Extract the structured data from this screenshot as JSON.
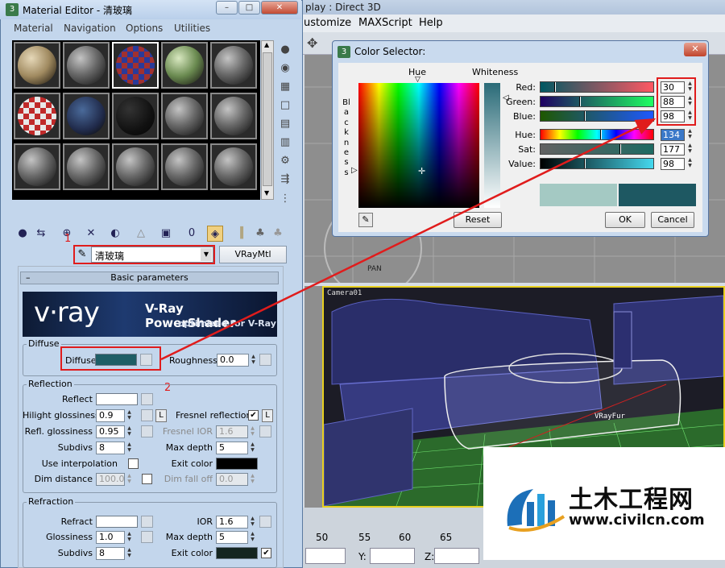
{
  "background": {
    "title": "play : Direct 3D",
    "menu": [
      "ustomize",
      "MAXScript",
      "Help"
    ],
    "camera_label": "Camera01",
    "vrayfur_label": "VRayFur",
    "pan_label": "PAN",
    "ruler": [
      "50",
      "55",
      "60",
      "65"
    ],
    "coord_y": "Y:",
    "coord_z": "Z:"
  },
  "material_editor": {
    "title": "Material Editor - 清玻璃",
    "menu": [
      "Material",
      "Navigation",
      "Options",
      "Utilities"
    ],
    "material_name": "清玻璃",
    "material_type": "VRayMtl",
    "rollout_title": "Basic parameters",
    "vray_banner": {
      "logo": "v·ray",
      "title": "V-Ray PowerShader",
      "subtitle": "optimized for V-Ray"
    },
    "diffuse": {
      "group": "Diffuse",
      "label": "Diffuse",
      "color": "#1e5e66",
      "roughness_label": "Roughness",
      "roughness": "0.0"
    },
    "reflection": {
      "group": "Reflection",
      "reflect_label": "Reflect",
      "reflect_color": "#ffffff",
      "hilight_label": "Hilight glossiness",
      "hilight": "0.9",
      "l_button": "L",
      "fresnel_label": "Fresnel reflections",
      "fresnel_checked": "✔",
      "refl_gloss_label": "Refl. glossiness",
      "refl_gloss": "0.95",
      "fresnel_ior_label": "Fresnel IOR",
      "fresnel_ior": "1.6",
      "subdivs_label": "Subdivs",
      "subdivs": "8",
      "max_depth_label": "Max depth",
      "max_depth": "5",
      "use_interp_label": "Use interpolation",
      "exit_color_label": "Exit color",
      "exit_color": "#000000",
      "dim_distance_label": "Dim distance",
      "dim_distance": "100.0m",
      "dim_falloff_label": "Dim fall off",
      "dim_falloff": "0.0"
    },
    "refraction": {
      "group": "Refraction",
      "refract_label": "Refract",
      "refract_color": "#ffffff",
      "ior_label": "IOR",
      "ior": "1.6",
      "glossiness_label": "Glossiness",
      "glossiness": "1.0",
      "max_depth_label": "Max depth",
      "max_depth": "5",
      "subdivs_label": "Subdivs",
      "subdivs": "8",
      "exit_color_label": "Exit color",
      "exit_color": "#142520"
    },
    "annotations": {
      "one": "1",
      "two": "2"
    }
  },
  "color_selector": {
    "title": "Color Selector:",
    "hue_label": "Hue",
    "whiteness_label": "Whiteness",
    "blackness_label": "Blackness",
    "channels": [
      {
        "label": "Red:",
        "value": "30"
      },
      {
        "label": "Green:",
        "value": "88"
      },
      {
        "label": "Blue:",
        "value": "98"
      },
      {
        "label": "Hue:",
        "value": "134"
      },
      {
        "label": "Sat:",
        "value": "177"
      },
      {
        "label": "Value:",
        "value": "98"
      }
    ],
    "reset_label": "Reset",
    "ok_label": "OK",
    "cancel_label": "Cancel",
    "old_color": "#a4c9c3",
    "new_color": "#1e5862"
  },
  "watermark": {
    "cn": "土木工程网",
    "url": "www.civilcn.com"
  }
}
